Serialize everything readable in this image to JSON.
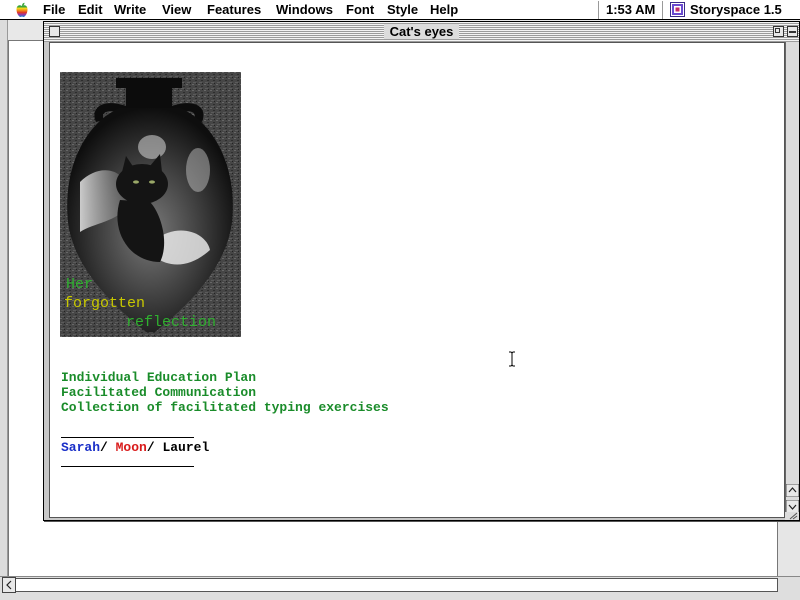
{
  "menubar": {
    "apple_icon": "apple-logo-icon",
    "menus": [
      "File",
      "Edit",
      "Write",
      "View",
      "Features",
      "Windows",
      "Font",
      "Style",
      "Help"
    ],
    "clock": "1:53 AM",
    "app_icon": "storyspace-app-icon",
    "app_name": "Storyspace 1.5"
  },
  "window": {
    "title": "Cat's eyes",
    "close_icon": "close-box-icon",
    "zoom_icon": "zoom-box-icon",
    "collapse_icon": "collapse-box-icon"
  },
  "content": {
    "image": {
      "icon": "vase-cat-image",
      "caption_lines": [
        "Her",
        "forgotten",
        "reflection"
      ],
      "caption_colors": [
        "#2fb02f",
        "#c8c800",
        "#2fb02f"
      ]
    },
    "text_lines": [
      "Individual Education Plan",
      "Facilitated Communication",
      "Collection of facilitated typing exercises"
    ],
    "text_color": "#1a8c2a",
    "links": {
      "sarah": "Sarah",
      "moon": "Moon",
      "laurel": "Laurel",
      "separator": "/ ",
      "colors": {
        "sarah": "#1a2fc8",
        "moon": "#d91a1a",
        "laurel": "#000000"
      }
    }
  },
  "cursor": "ibeam-cursor-icon"
}
